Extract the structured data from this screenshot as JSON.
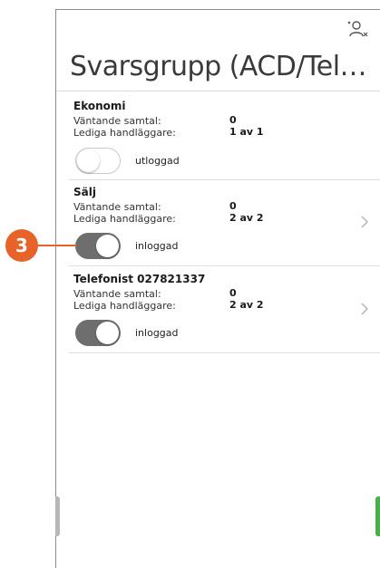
{
  "header": {
    "title": "Svarsgrupp (ACD/Telefonist)",
    "user_icon": "user-switch-icon"
  },
  "groups": [
    {
      "name": "Ekonomi",
      "waiting_label": "Väntande samtal:",
      "waiting_value": "0",
      "agents_label": "Lediga handläggare:",
      "agents_value": "1 av 1",
      "toggle_on": false,
      "status": "utloggad",
      "has_chevron": false
    },
    {
      "name": "Sälj",
      "waiting_label": "Väntande samtal:",
      "waiting_value": "0",
      "agents_label": "Lediga handläggare:",
      "agents_value": "2 av 2",
      "toggle_on": true,
      "status": "inloggad",
      "has_chevron": true
    },
    {
      "name": "Telefonist 027821337",
      "waiting_label": "Väntande samtal:",
      "waiting_value": "0",
      "agents_label": "Lediga handläggare:",
      "agents_value": "2 av 2",
      "toggle_on": true,
      "status": "inloggad",
      "has_chevron": true
    }
  ],
  "callout": {
    "number": "3",
    "color": "#e8632a"
  },
  "colors": {
    "toggle_on": "#6e6e6e",
    "accent_green": "#48b04a"
  }
}
